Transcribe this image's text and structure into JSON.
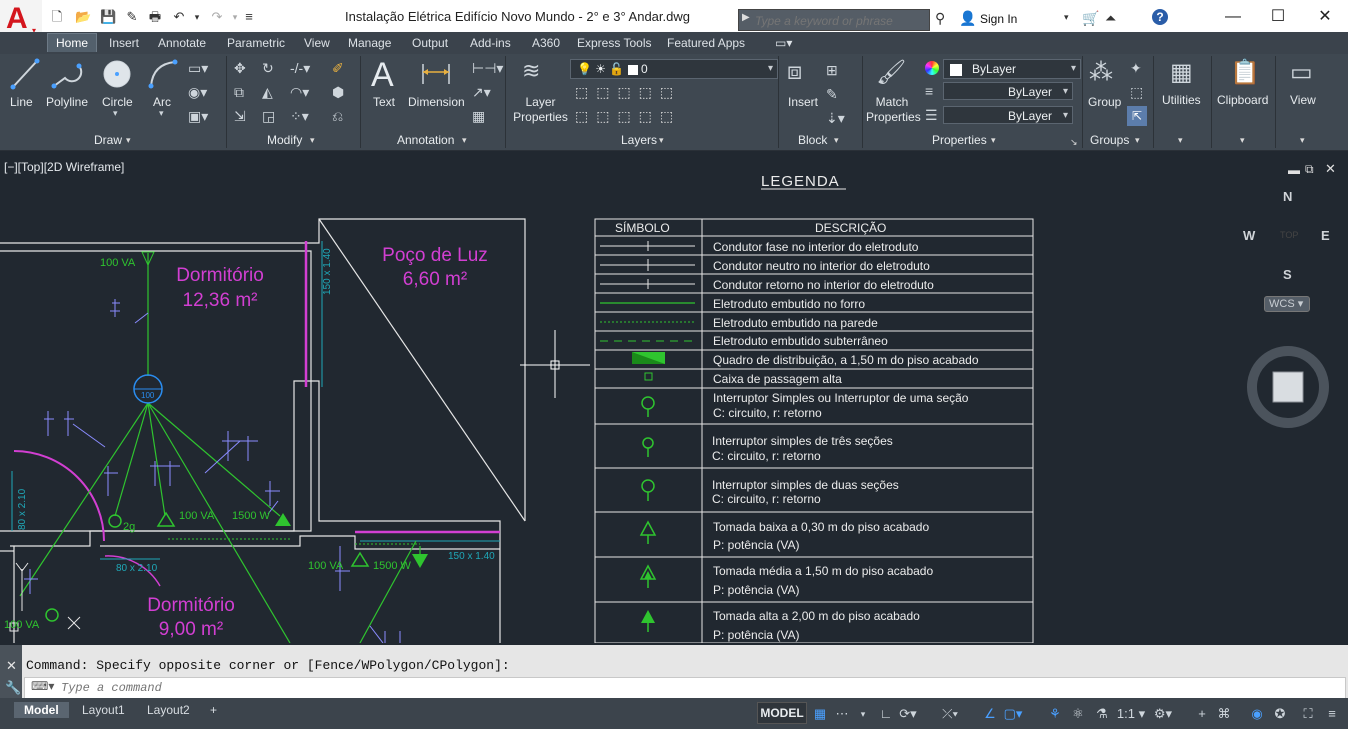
{
  "title_bar": {
    "document_title": "Instalação Elétrica Edifício Novo Mundo - 2° e 3° Andar.dwg",
    "search_placeholder": "Type a keyword or phrase",
    "sign_in": "Sign In"
  },
  "ribbon_tabs": [
    "Home",
    "Insert",
    "Annotate",
    "Parametric",
    "View",
    "Manage",
    "Output",
    "Add-ins",
    "A360",
    "Express Tools",
    "Featured Apps"
  ],
  "ribbon": {
    "draw": {
      "title": "Draw",
      "tools": [
        "Line",
        "Polyline",
        "Circle",
        "Arc"
      ]
    },
    "modify": {
      "title": "Modify"
    },
    "annotation": {
      "title": "Annotation",
      "tools": [
        "Text",
        "Dimension"
      ]
    },
    "layers": {
      "title": "Layers",
      "tool": "Layer Properties",
      "current_layer": "0"
    },
    "block": {
      "title": "Block",
      "tool": "Insert"
    },
    "properties": {
      "title": "Properties",
      "tool": "Match Properties",
      "color": "ByLayer",
      "linetype": "ByLayer",
      "lineweight": "ByLayer"
    },
    "groups": {
      "title": "Groups",
      "tool": "Group"
    },
    "utilities": "Utilities",
    "clipboard": "Clipboard",
    "view": "View"
  },
  "viewport": {
    "label": "[−][Top][2D Wireframe]",
    "viewcube": {
      "n": "N",
      "s": "S",
      "e": "E",
      "w": "W",
      "top": "TOP",
      "wcs": "WCS"
    }
  },
  "drawing": {
    "rooms": [
      {
        "name": "Dormitório",
        "area": "12,36 m²"
      },
      {
        "name": "Poço de Luz",
        "area": "6,60 m²"
      },
      {
        "name": "Dormitório",
        "area": "9,00 m²"
      }
    ],
    "annotations": [
      "100 VA",
      "150 x 1.40",
      "100 VA",
      "1500 W",
      "2g",
      "80 x 2.10",
      "80 x 2.10",
      "100 VA",
      "1500 W",
      "150 x 1.40",
      "100 VA",
      "100"
    ],
    "legend": {
      "title": "LEGENDA",
      "col_symbol": "SÍMBOLO",
      "col_description": "DESCRIÇÃO",
      "rows": [
        [
          "Condutor fase no interior do eletroduto"
        ],
        [
          "Condutor neutro no interior do eletroduto"
        ],
        [
          "Condutor retorno no interior do eletroduto"
        ],
        [
          "Eletroduto embutido no forro"
        ],
        [
          "Eletroduto embutido na parede"
        ],
        [
          "Eletroduto embutido subterrâneo"
        ],
        [
          "Quadro de distribuição, a 1,50 m do piso acabado"
        ],
        [
          "Caixa de passagem alta"
        ],
        [
          "Interruptor Simples ou Interruptor de uma seção",
          "C: circuito, r: retorno"
        ],
        [
          "Interruptor simples de três seções",
          "C: circuito, r: retorno"
        ],
        [
          "Interruptor simples de duas seções",
          "C: circuito, r: retorno"
        ],
        [
          "Tomada baixa a 0,30 m do piso acabado",
          "P: potência (VA)"
        ],
        [
          "Tomada média a 1,50 m do piso acabado",
          "P: potência (VA)"
        ],
        [
          "Tomada alta a 2,00 m do piso acabado",
          "P: potência (VA)"
        ]
      ]
    }
  },
  "command_line": {
    "history": "Command: Specify opposite corner or [Fence/WPolygon/CPolygon]:",
    "placeholder": "Type a command"
  },
  "status": {
    "layout_tabs": [
      "Model",
      "Layout1",
      "Layout2"
    ],
    "model_label": "MODEL",
    "scale": "1:1"
  },
  "colors": {
    "accent": "#2c8be0",
    "drawing_bg": "#212830",
    "room_text": "#d23fd2",
    "wire": "#2fc42f"
  }
}
